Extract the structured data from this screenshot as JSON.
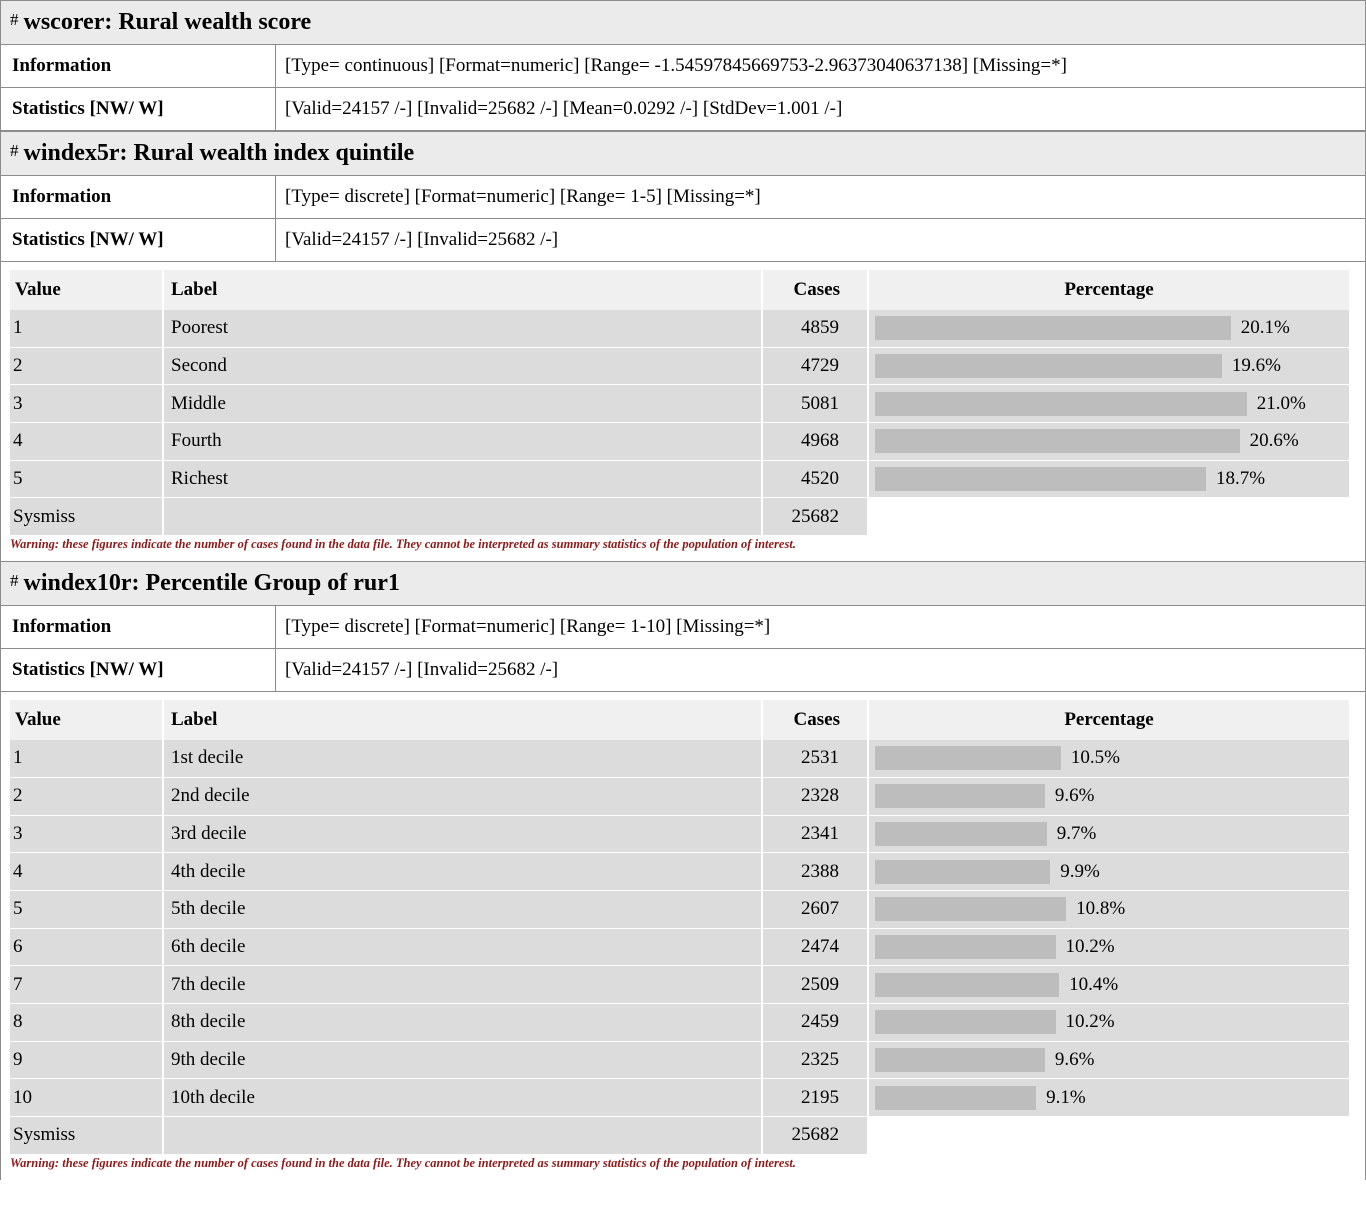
{
  "variables": [
    {
      "hash": "#",
      "title": "wscorer: Rural wealth score",
      "information_label": "Information",
      "information": "[Type= continuous] [Format=numeric] [Range= -1.54597845669753-2.96373040637138] [Missing=*]",
      "statistics_label": "Statistics [NW/ W]",
      "statistics": "[Valid=24157 /-] [Invalid=25682 /-] [Mean=0.0292 /-] [StdDev=1.001 /-]"
    },
    {
      "hash": "#",
      "title": "windex5r: Rural wealth index quintile",
      "information_label": "Information",
      "information": "[Type= discrete] [Format=numeric] [Range= 1-5] [Missing=*]",
      "statistics_label": "Statistics [NW/ W]",
      "statistics": "[Valid=24157 /-] [Invalid=25682 /-]",
      "table": {
        "headers": [
          "Value",
          "Label",
          "Cases",
          "Percentage"
        ],
        "rows": [
          {
            "value": "1",
            "label": "Poorest",
            "cases": "4859",
            "pct": 20.1,
            "pct_text": "20.1%"
          },
          {
            "value": "2",
            "label": "Second",
            "cases": "4729",
            "pct": 19.6,
            "pct_text": "19.6%"
          },
          {
            "value": "3",
            "label": "Middle",
            "cases": "5081",
            "pct": 21.0,
            "pct_text": "21.0%"
          },
          {
            "value": "4",
            "label": "Fourth",
            "cases": "4968",
            "pct": 20.6,
            "pct_text": "20.6%"
          },
          {
            "value": "5",
            "label": "Richest",
            "cases": "4520",
            "pct": 18.7,
            "pct_text": "18.7%"
          }
        ],
        "sysmiss_label": "Sysmiss",
        "sysmiss_cases": "25682",
        "warning": "Warning: these figures indicate the number of cases found in the data file. They cannot be interpreted as summary statistics of the population of interest."
      }
    },
    {
      "hash": "#",
      "title": "windex10r: Percentile Group of rur1",
      "information_label": "Information",
      "information": "[Type= discrete] [Format=numeric] [Range= 1-10] [Missing=*]",
      "statistics_label": "Statistics [NW/ W]",
      "statistics": "[Valid=24157 /-] [Invalid=25682 /-]",
      "table": {
        "headers": [
          "Value",
          "Label",
          "Cases",
          "Percentage"
        ],
        "rows": [
          {
            "value": "1",
            "label": "1st decile",
            "cases": "2531",
            "pct": 10.5,
            "pct_text": "10.5%"
          },
          {
            "value": "2",
            "label": "2nd decile",
            "cases": "2328",
            "pct": 9.6,
            "pct_text": "9.6%"
          },
          {
            "value": "3",
            "label": "3rd decile",
            "cases": "2341",
            "pct": 9.7,
            "pct_text": "9.7%"
          },
          {
            "value": "4",
            "label": "4th decile",
            "cases": "2388",
            "pct": 9.9,
            "pct_text": "9.9%"
          },
          {
            "value": "5",
            "label": "5th decile",
            "cases": "2607",
            "pct": 10.8,
            "pct_text": "10.8%"
          },
          {
            "value": "6",
            "label": "6th decile",
            "cases": "2474",
            "pct": 10.2,
            "pct_text": "10.2%"
          },
          {
            "value": "7",
            "label": "7th decile",
            "cases": "2509",
            "pct": 10.4,
            "pct_text": "10.4%"
          },
          {
            "value": "8",
            "label": "8th decile",
            "cases": "2459",
            "pct": 10.2,
            "pct_text": "10.2%"
          },
          {
            "value": "9",
            "label": "9th decile",
            "cases": "2325",
            "pct": 9.6,
            "pct_text": "9.6%"
          },
          {
            "value": "10",
            "label": "10th decile",
            "cases": "2195",
            "pct": 9.1,
            "pct_text": "9.1%"
          }
        ],
        "sysmiss_label": "Sysmiss",
        "sysmiss_cases": "25682",
        "warning": "Warning: these figures indicate the number of cases found in the data file. They cannot be interpreted as summary statistics of the population of interest."
      }
    }
  ]
}
